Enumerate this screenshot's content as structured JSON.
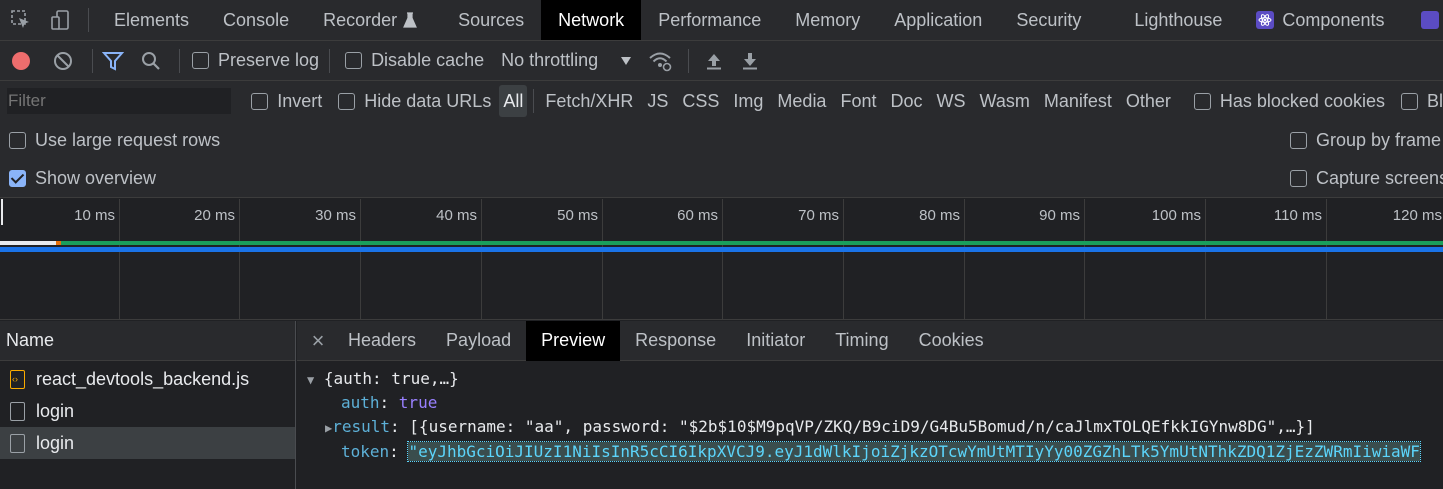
{
  "tabs": [
    "Elements",
    "Console",
    "Recorder",
    "Sources",
    "Network",
    "Performance",
    "Memory",
    "Application",
    "Security",
    "Lighthouse",
    "Components"
  ],
  "active_tab": "Network",
  "toolbar": {
    "preserve_log": "Preserve log",
    "disable_cache": "Disable cache",
    "throttling": "No throttling"
  },
  "filter": {
    "placeholder": "Filter",
    "invert": "Invert",
    "hide_data_urls": "Hide data URLs",
    "types": [
      "All",
      "Fetch/XHR",
      "JS",
      "CSS",
      "Img",
      "Media",
      "Font",
      "Doc",
      "WS",
      "Wasm",
      "Manifest",
      "Other"
    ],
    "has_blocked_cookies": "Has blocked cookies",
    "blocked_requests": "Bl"
  },
  "options": {
    "large_rows": "Use large request rows",
    "show_overview": "Show overview",
    "group_by_frame": "Group by frame",
    "capture_screenshots": "Capture screensh"
  },
  "timeline": {
    "ticks": [
      "10 ms",
      "20 ms",
      "30 ms",
      "40 ms",
      "50 ms",
      "60 ms",
      "70 ms",
      "80 ms",
      "90 ms",
      "100 ms",
      "110 ms",
      "120 ms"
    ]
  },
  "requests": {
    "header": "Name",
    "items": [
      {
        "name": "react_devtools_backend.js",
        "type": "js"
      },
      {
        "name": "login",
        "type": "doc"
      },
      {
        "name": "login",
        "type": "doc"
      }
    ]
  },
  "detail": {
    "close": "×",
    "tabs": [
      "Headers",
      "Payload",
      "Preview",
      "Response",
      "Initiator",
      "Timing",
      "Cookies"
    ],
    "active_tab": "Preview",
    "preview": {
      "root": "{auth: true,…}",
      "auth_key": "auth",
      "auth_value": "true",
      "result_key": "result",
      "result_value": "[{username: \"aa\", password: \"$2b$10$M9pqVP/ZKQ/B9ciD9/G4Bu5Bomud/n/caJlmxTOLQEfkkIGYnw8DG\",…}]",
      "token_key": "token",
      "token_value": "\"eyJhbGciOiJIUzI1NiIsInR5cCI6IkpXVCJ9.eyJ1dWlkIjoiZjkzOTcwYmUtMTIyYy00ZGZhLTk5YmUtNThkZDQ1ZjEzZWRmIiwiaWF"
    }
  },
  "colors": {
    "bg": "#202124",
    "toolbar_bg": "#292a2d",
    "record_red": "#ee6d6d",
    "filter_blue": "#8ab4f8",
    "bar_green": "#1a9e5c",
    "bar_blue": "#1a73e8",
    "token_cyan": "#5cd5fb"
  }
}
